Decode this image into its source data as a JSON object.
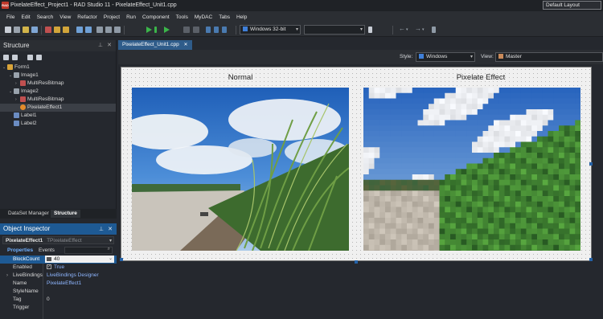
{
  "titlebar": {
    "title": "PixelateEffect_Project1 - RAD Studio 11 - PixelateEffect_Unit1.cpp",
    "layout_label": "Default Layout",
    "app_icon_text": "RAD"
  },
  "menu": [
    "File",
    "Edit",
    "Search",
    "View",
    "Refactor",
    "Project",
    "Run",
    "Component",
    "Tools",
    "MyDAC",
    "Tabs",
    "Help"
  ],
  "toolbar": {
    "platform_combo": "Windows 32-bit",
    "config_combo": ""
  },
  "structure": {
    "title": "Structure",
    "tree": [
      {
        "label": "Form1",
        "level": 0,
        "icon": "form-icon",
        "color": "#d9a43a"
      },
      {
        "label": "Image1",
        "level": 1,
        "icon": "image-icon",
        "color": "#9aa3ad"
      },
      {
        "label": "MultiResBitmap",
        "level": 2,
        "icon": "bitmap-icon",
        "color": "#c05050"
      },
      {
        "label": "Image2",
        "level": 1,
        "icon": "image-icon",
        "color": "#9aa3ad"
      },
      {
        "label": "MultiResBitmap",
        "level": 2,
        "icon": "bitmap-icon",
        "color": "#c05050"
      },
      {
        "label": "PixelateEffect1",
        "level": 2,
        "icon": "effect-icon",
        "color": "#e38b2b",
        "selected": true
      },
      {
        "label": "Label1",
        "level": 1,
        "icon": "label-icon",
        "color": "#6b8cc2"
      },
      {
        "label": "Label2",
        "level": 1,
        "icon": "label-icon",
        "color": "#6b8cc2"
      }
    ],
    "tabs": [
      "DataSet Manager",
      "Structure"
    ]
  },
  "object_inspector": {
    "title": "Object Inspector",
    "selected_name": "PixelateEffect1",
    "selected_type": "TPixelateEffect",
    "tabs": [
      "Properties",
      "Events"
    ],
    "properties": [
      {
        "name": "BlockCount",
        "value": "40",
        "selected": true
      },
      {
        "name": "Enabled",
        "value": "True"
      },
      {
        "name": "LiveBindings",
        "value": "LiveBindings Designer",
        "expandable": true
      },
      {
        "name": "Name",
        "value": "PixelateEffect1"
      },
      {
        "name": "StyleName",
        "value": ""
      },
      {
        "name": "Tag",
        "value": "0"
      },
      {
        "name": "Trigger",
        "value": ""
      }
    ]
  },
  "editor": {
    "file_tab": "PixelateEffect_Unit1.cpp",
    "style_label": "Style:",
    "style_value": "Windows",
    "view_label": "View:",
    "view_value": "Master"
  },
  "form": {
    "label_normal": "Normal",
    "label_pixelate": "Pixelate Effect"
  },
  "colors": {
    "accent": "#1e5a94",
    "tab_active": "#2f5c8a"
  }
}
